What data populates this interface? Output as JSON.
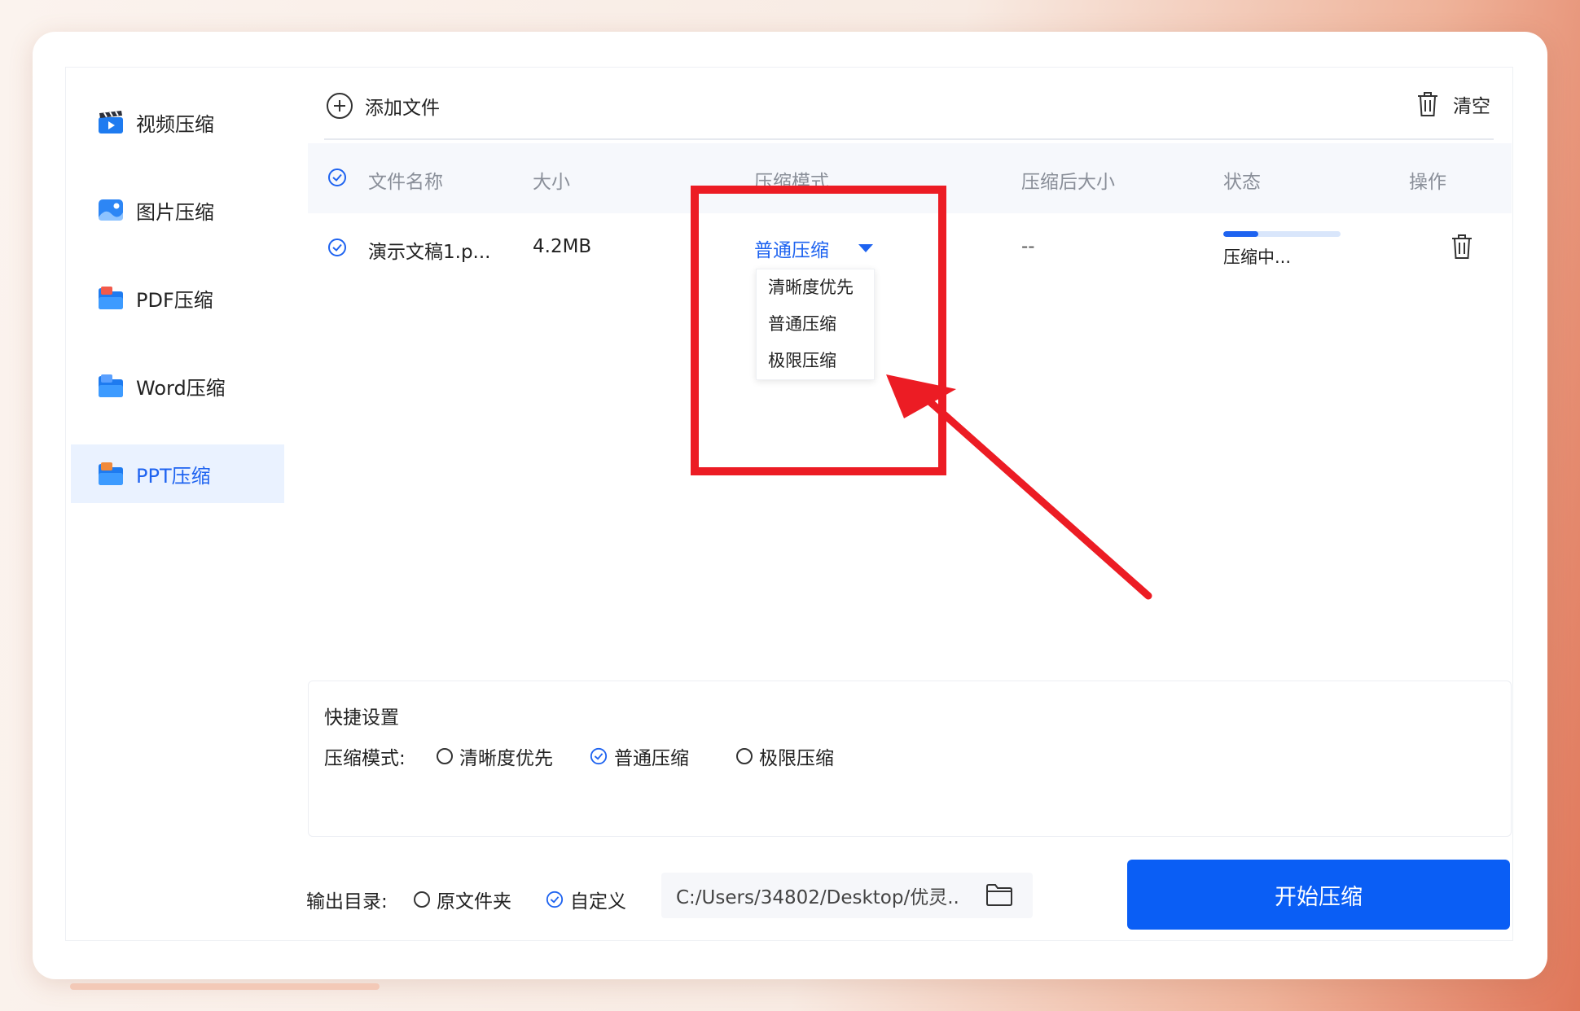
{
  "sidebar": {
    "items": [
      {
        "label": "视频压缩",
        "icon": "video-clapper-icon",
        "active": false
      },
      {
        "label": "图片压缩",
        "icon": "image-icon",
        "active": false
      },
      {
        "label": "PDF压缩",
        "icon": "pdf-folder-icon",
        "active": false
      },
      {
        "label": "Word压缩",
        "icon": "word-folder-icon",
        "active": false
      },
      {
        "label": "PPT压缩",
        "icon": "ppt-folder-icon",
        "active": true
      }
    ]
  },
  "toolbar": {
    "add_file_label": "添加文件",
    "clear_label": "清空"
  },
  "table": {
    "headers": {
      "name": "文件名称",
      "size": "大小",
      "mode": "压缩模式",
      "compressed_size": "压缩后大小",
      "status": "状态",
      "actions": "操作"
    },
    "rows": [
      {
        "name": "演示文稿1.p...",
        "size": "4.2MB",
        "mode": "普通压缩",
        "compressed_size": "--",
        "status": "压缩中...",
        "progress_percent": 30
      }
    ]
  },
  "mode_dropdown": {
    "options": [
      "清晰度优先",
      "普通压缩",
      "极限压缩"
    ]
  },
  "quick_settings": {
    "title": "快捷设置",
    "mode_label": "压缩模式:",
    "options": [
      {
        "label": "清晰度优先",
        "checked": false
      },
      {
        "label": "普通压缩",
        "checked": true
      },
      {
        "label": "极限压缩",
        "checked": false
      }
    ]
  },
  "output": {
    "label": "输出目录:",
    "options": [
      {
        "label": "原文件夹",
        "checked": false
      },
      {
        "label": "自定义",
        "checked": true
      }
    ],
    "path": "C:/Users/34802/Desktop/优灵.."
  },
  "start_button_label": "开始压缩",
  "colors": {
    "accent": "#1e63f0",
    "start_button": "#0a5ef5",
    "annotation": "#ec1c24"
  }
}
